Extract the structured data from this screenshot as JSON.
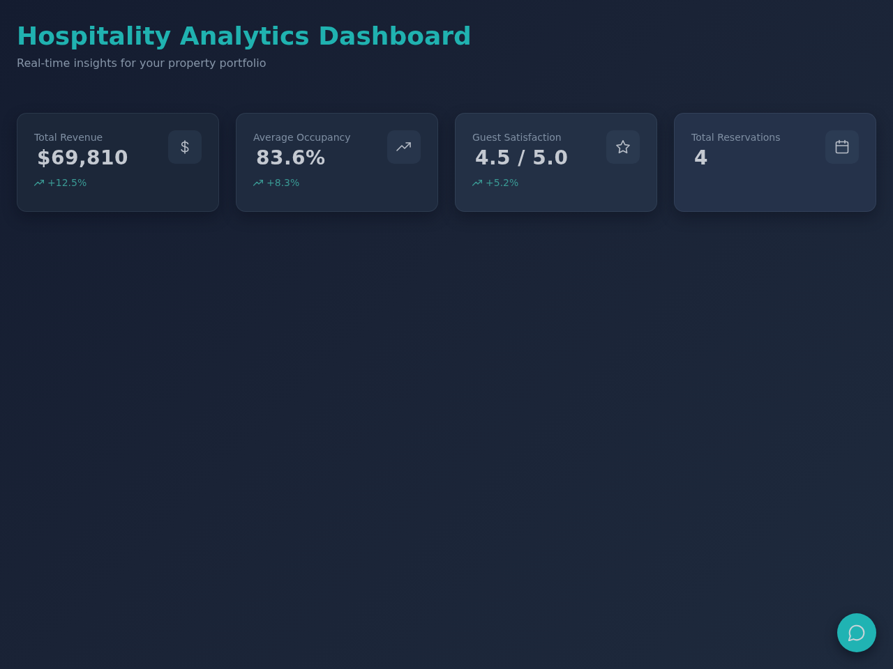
{
  "header": {
    "title": "Hospitality Analytics Dashboard",
    "subtitle": "Real-time insights for your property portfolio"
  },
  "stats": [
    {
      "label": "Total Revenue",
      "value": "$69,810",
      "change": "+12.5%"
    },
    {
      "label": "Average Occupancy",
      "value": "83.6%",
      "change": "+8.3%"
    },
    {
      "label": "Guest Satisfaction",
      "value": "4.5 / 5.0",
      "change": "+5.2%"
    },
    {
      "label": "Total Reservations",
      "value": "4"
    }
  ]
}
